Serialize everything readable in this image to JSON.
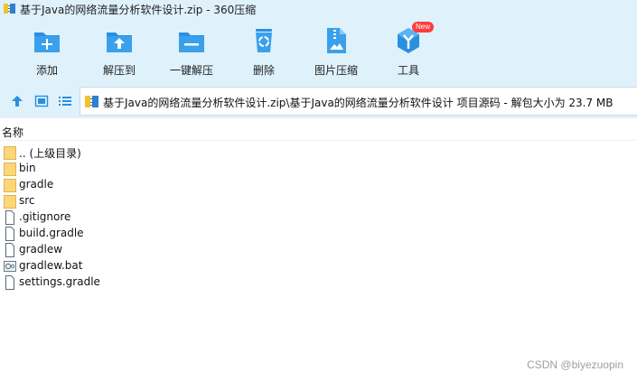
{
  "window": {
    "title": "基于Java的网络流量分析软件设计.zip - 360压缩"
  },
  "toolbar": {
    "add": "添加",
    "extract_to": "解压到",
    "one_click_extract": "一键解压",
    "delete": "删除",
    "image_compress": "图片压缩",
    "tools": "工具",
    "tools_badge": "New"
  },
  "address": {
    "path": "基于Java的网络流量分析软件设计.zip\\基于Java的网络流量分析软件设计 项目源码 - 解包大小为 23.7 MB"
  },
  "list": {
    "column_name": "名称",
    "items": [
      {
        "name": ".. (上级目录)",
        "icon": "folder-icon"
      },
      {
        "name": "bin",
        "icon": "folder-icon"
      },
      {
        "name": "gradle",
        "icon": "folder-icon"
      },
      {
        "name": "src",
        "icon": "folder-icon"
      },
      {
        "name": ".gitignore",
        "icon": "file-icon"
      },
      {
        "name": "build.gradle",
        "icon": "file-icon"
      },
      {
        "name": "gradlew",
        "icon": "file-icon"
      },
      {
        "name": "gradlew.bat",
        "icon": "batch-file-icon"
      },
      {
        "name": "settings.gradle",
        "icon": "file-icon"
      }
    ]
  },
  "watermark": "CSDN @biyezuopin",
  "colors": {
    "accent": "#2b8fe0",
    "toolbar_bg": "#dff1fb",
    "folder": "#fcd77a"
  }
}
